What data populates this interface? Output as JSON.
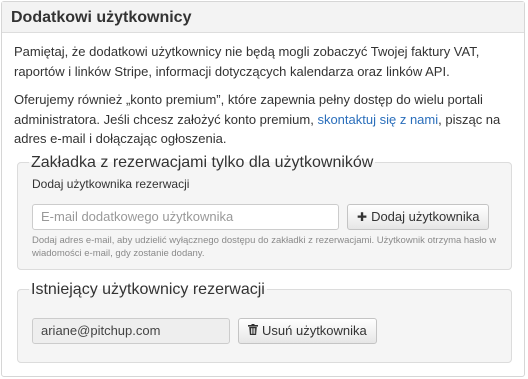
{
  "panel": {
    "title": "Dodatkowi użytkownicy",
    "intro": "Pamiętaj, że dodatkowi użytkownicy nie będą mogli zobaczyć Twojej faktury VAT, raportów i linków Stripe, informacji dotyczących kalendarza oraz linków API.",
    "offer_before": "Oferujemy również „konto premium”, które zapewnia pełny dostęp do wielu portali administratora. Jeśli chcesz założyć konto premium, ",
    "offer_link": "skontaktuj się z nami",
    "offer_after": ", pisząc na adres e-mail i dołączając ogłoszenia."
  },
  "add_section": {
    "legend": "Zakładka z rezerwacjami tylko dla użytkowników",
    "field_label": "Dodaj użytkownika rezerwacji",
    "email_placeholder": "E-mail dodatkowego użytkownika",
    "add_button": "Dodaj użytkownika",
    "add_icon": "plus-icon",
    "help": "Dodaj adres e-mail, aby udzielić wyłącznego dostępu do zakładki z rezerwacjami. Użytkownik otrzyma hasło w wiadomości e-mail, gdy zostanie dodany."
  },
  "existing_section": {
    "legend": "Istniejący użytkownicy rezerwacji",
    "users": [
      {
        "email": "ariane@pitchup.com",
        "remove_button": "Usuń użytkownika",
        "remove_icon": "trash-icon"
      }
    ]
  },
  "colors": {
    "link": "#2a6ebb",
    "header_bg": "#f3f3f3",
    "fieldset_bg": "#f5f5f5"
  }
}
